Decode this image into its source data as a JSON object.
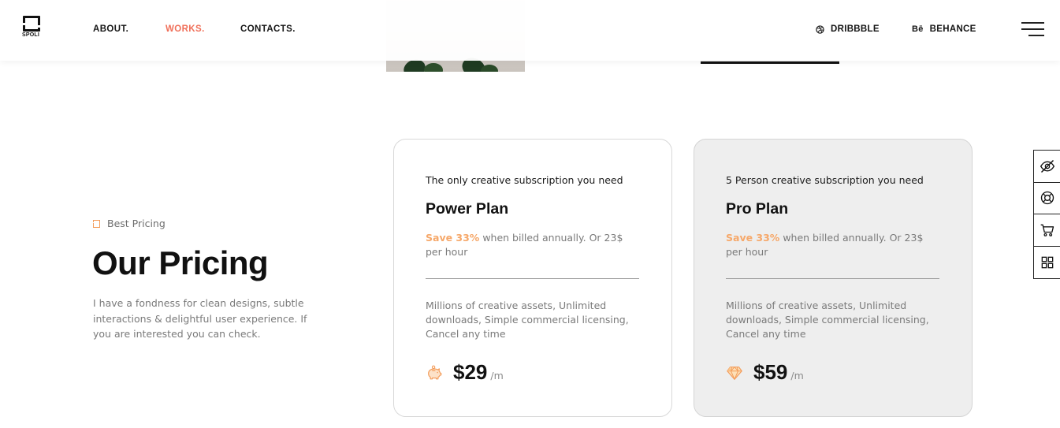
{
  "header": {
    "logo_text": "SPOLI",
    "nav": [
      {
        "label": "ABOUT.",
        "active": false
      },
      {
        "label": "WORKS.",
        "active": true
      },
      {
        "label": "CONTACTS.",
        "active": false
      }
    ],
    "social": [
      {
        "icon": "dribbble-icon",
        "label": "DRIBBBLE"
      },
      {
        "icon": "behance-icon",
        "glyph": "Bē",
        "label": "BEHANCE"
      }
    ],
    "menu_icon": "hamburger-icon"
  },
  "intro": {
    "eyebrow": "Best Pricing",
    "title": "Our Pricing",
    "description": "I have a fondness for clean designs, subtle interactions & delightful user experience. If you are interested you can check."
  },
  "plans": [
    {
      "subtitle": "The only creative subscription you need",
      "name": "Power Plan",
      "save_highlight": "Save 33%",
      "save_text": " when billed annually. Or 23$ per hour",
      "description": "Millions of creative assets, Unlimited downloads, Simple commercial licensing, Cancel any time",
      "icon": "piggy-bank-icon",
      "price": "$29",
      "period": "/m"
    },
    {
      "subtitle": "5 Person creative subscription you need",
      "name": "Pro Plan",
      "save_highlight": "Save 33%",
      "save_text": " when billed annually. Or 23$ per hour",
      "description": "Millions of creative assets, Unlimited downloads, Simple commercial licensing, Cancel any time",
      "icon": "diamond-icon",
      "price": "$59",
      "period": "/m"
    }
  ],
  "toolbar": [
    "eye-off-icon",
    "lifebuoy-icon",
    "cart-icon",
    "grid-icon"
  ],
  "colors": {
    "accent": "#f0705a",
    "save_orange": "#f6a86a",
    "text_dark": "#111111",
    "text_muted": "#7a7a7a",
    "alt_card_bg": "#eeeeee"
  }
}
